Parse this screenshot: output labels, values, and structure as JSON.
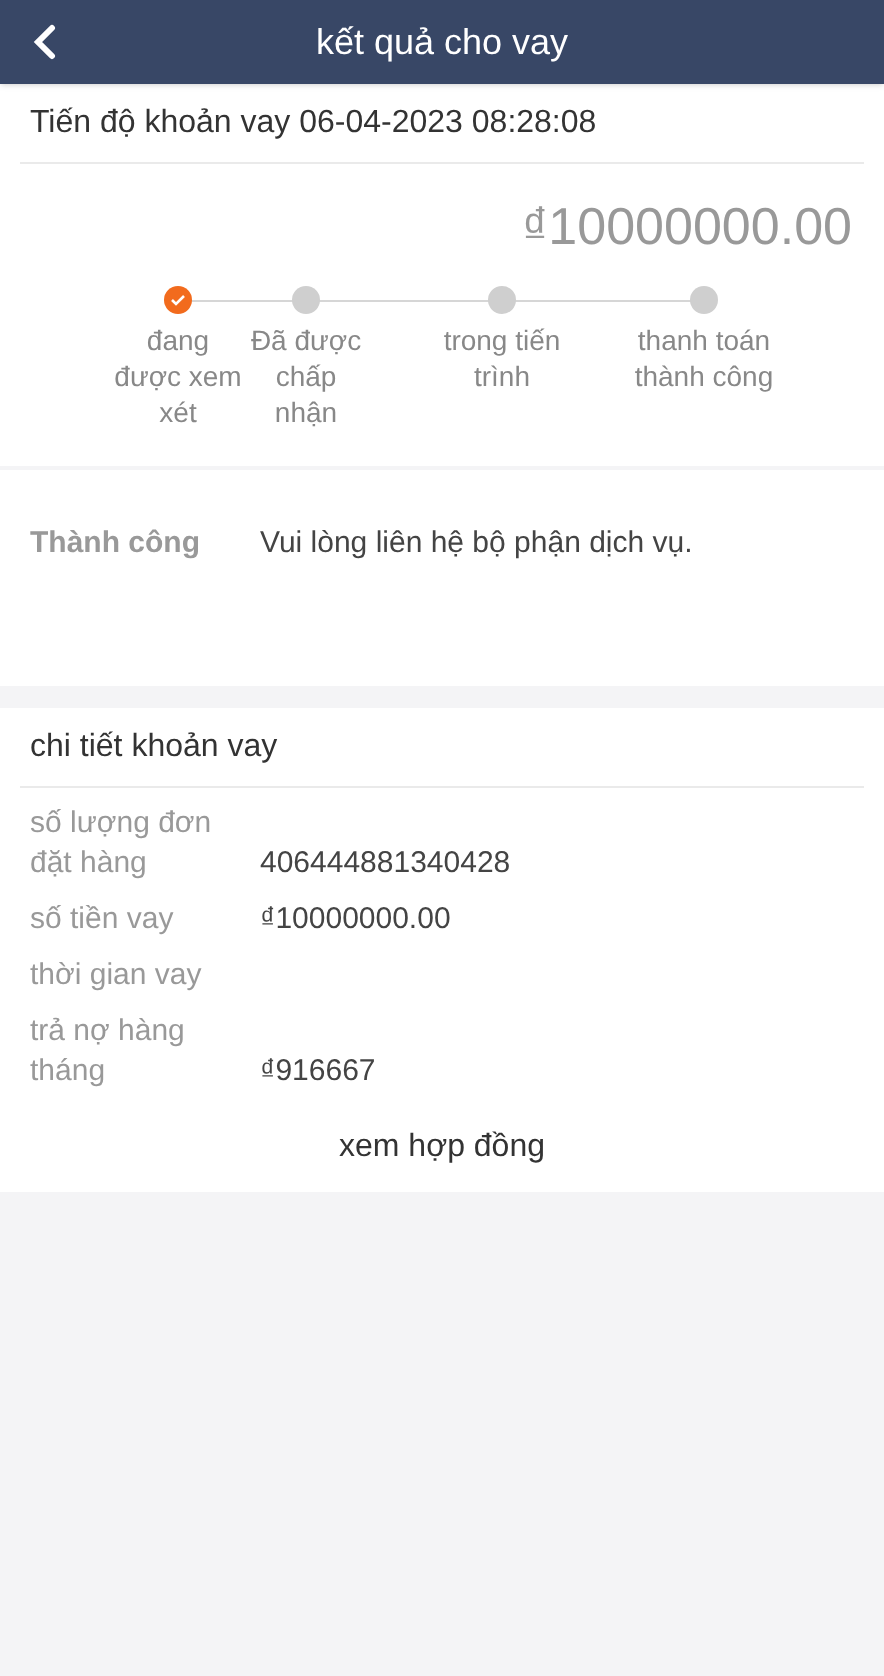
{
  "header": {
    "title": "kết quả cho vay"
  },
  "progress": {
    "title": "Tiến độ khoản vay 06-04-2023 08:28:08",
    "amount": "₫10000000.00",
    "steps": [
      {
        "label": "đang được xem xét",
        "done": true
      },
      {
        "label": "Đã được chấp nhận",
        "done": false
      },
      {
        "label": "trong tiến trình",
        "done": false
      },
      {
        "label": "thanh toán thành công",
        "done": false
      }
    ]
  },
  "status": {
    "label": "Thành công",
    "message": "Vui lòng liên hệ bộ phận dịch vụ."
  },
  "details": {
    "title": "chi tiết khoản vay",
    "rows": [
      {
        "label": "số lượng đơn đặt hàng",
        "value": "406444881340428"
      },
      {
        "label": "số tiền vay",
        "value": "₫10000000.00"
      },
      {
        "label": "thời gian vay"
      },
      {
        "label": "trả nợ hàng tháng",
        "value": "₫916667"
      }
    ],
    "link": "xem hợp đồng"
  }
}
